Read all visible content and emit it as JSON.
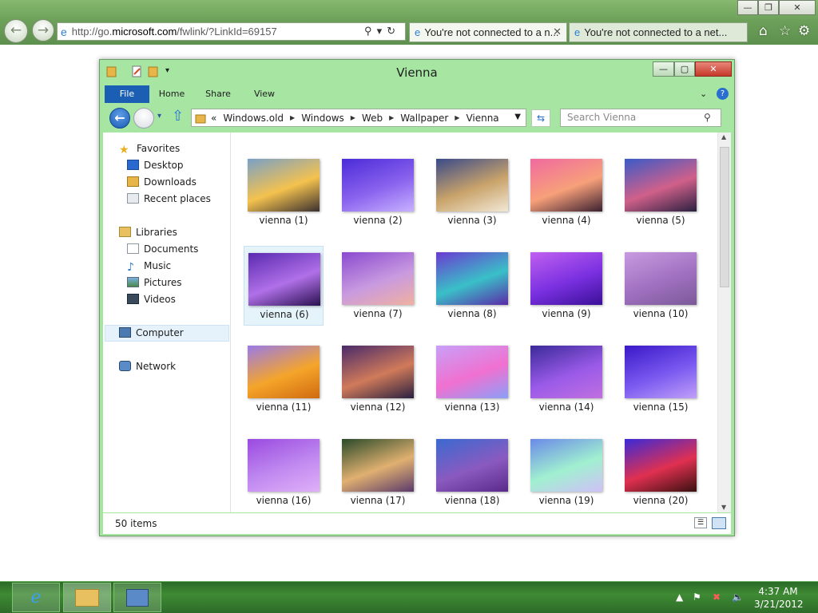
{
  "browser": {
    "address_prefix": "http://go.",
    "address_host": "microsoft.com",
    "address_suffix": "/fwlink/?LinkId=69157",
    "tabs": [
      {
        "label": "You're not connected to a n..."
      },
      {
        "label": "You're not connected to a net..."
      }
    ]
  },
  "window": {
    "title": "Vienna",
    "ribbon_tabs": [
      "File",
      "Home",
      "Share",
      "View"
    ],
    "path": [
      "Windows.old",
      "Windows",
      "Web",
      "Wallpaper",
      "Vienna"
    ],
    "path_overflow": "«",
    "search_placeholder": "Search Vienna"
  },
  "navpane": {
    "favorites": {
      "label": "Favorites",
      "items": [
        "Desktop",
        "Downloads",
        "Recent places"
      ]
    },
    "libraries": {
      "label": "Libraries",
      "items": [
        "Documents",
        "Music",
        "Pictures",
        "Videos"
      ]
    },
    "computer": "Computer",
    "network": "Network"
  },
  "files": [
    {
      "name": "vienna (1)",
      "colors": [
        "#7aa0c8",
        "#f4c24e",
        "#3a3030"
      ]
    },
    {
      "name": "vienna (2)",
      "colors": [
        "#4a2bd8",
        "#8a62ee",
        "#c8b2ff"
      ]
    },
    {
      "name": "vienna (3)",
      "colors": [
        "#3a4a8a",
        "#c9a36a",
        "#f2e8d6"
      ]
    },
    {
      "name": "vienna (4)",
      "colors": [
        "#f06aa0",
        "#f7a07a",
        "#3a2030"
      ]
    },
    {
      "name": "vienna (5)",
      "colors": [
        "#3a5ac8",
        "#d0608a",
        "#2a2040"
      ]
    },
    {
      "name": "vienna (6)",
      "colors": [
        "#5a2ab0",
        "#b070e8",
        "#2a1050"
      ]
    },
    {
      "name": "vienna (7)",
      "colors": [
        "#8a4ad0",
        "#c89ae0",
        "#f0b0a0"
      ]
    },
    {
      "name": "vienna (8)",
      "colors": [
        "#6a3ad0",
        "#3ac0c8",
        "#5a2aa8"
      ]
    },
    {
      "name": "vienna (9)",
      "colors": [
        "#c060f0",
        "#7a30e0",
        "#3a1098"
      ]
    },
    {
      "name": "vienna (10)",
      "colors": [
        "#c89ae0",
        "#a070c0",
        "#7a5a98"
      ]
    },
    {
      "name": "vienna (11)",
      "colors": [
        "#9a7ae8",
        "#f5a52a",
        "#d06a10"
      ]
    },
    {
      "name": "vienna (12)",
      "colors": [
        "#4a2a6a",
        "#d07a5a",
        "#2a2040"
      ]
    },
    {
      "name": "vienna (13)",
      "colors": [
        "#c8a0f8",
        "#f070d0",
        "#8aa0f8"
      ]
    },
    {
      "name": "vienna (14)",
      "colors": [
        "#3a2a98",
        "#9a5ae8",
        "#c070e0"
      ]
    },
    {
      "name": "vienna (15)",
      "colors": [
        "#3a18c8",
        "#7a5af0",
        "#c0a0f8"
      ]
    },
    {
      "name": "vienna (16)",
      "colors": [
        "#9a4ae0",
        "#c08af0",
        "#e0b0f8"
      ]
    },
    {
      "name": "vienna (17)",
      "colors": [
        "#2a4a2a",
        "#e0b070",
        "#5a3a6a"
      ]
    },
    {
      "name": "vienna (18)",
      "colors": [
        "#3a6ad0",
        "#8a5ac0",
        "#5a2a8a"
      ]
    },
    {
      "name": "vienna (19)",
      "colors": [
        "#6a8ae8",
        "#a0f0d0",
        "#d0c0f8"
      ]
    },
    {
      "name": "vienna (20)",
      "colors": [
        "#3a2ad8",
        "#e03050",
        "#3a1010"
      ]
    }
  ],
  "status": {
    "count": "50 items"
  },
  "taskbar": {
    "time": "4:37 AM",
    "date": "3/21/2012"
  }
}
